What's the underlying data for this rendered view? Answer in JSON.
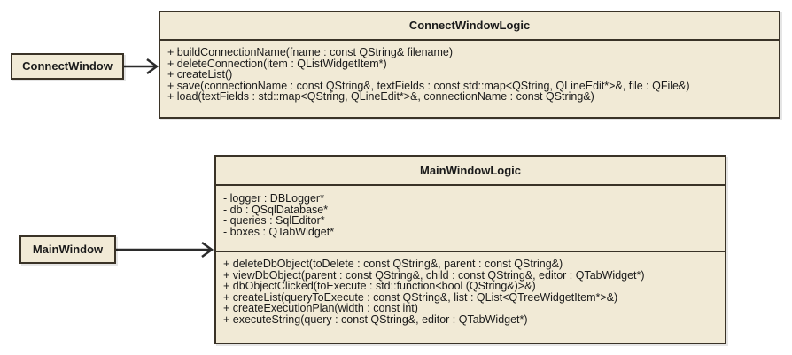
{
  "colors": {
    "box_fill": "#f1ead6",
    "border": "#3a3327",
    "text": "#1a1a1a"
  },
  "connect_window_logic": {
    "title": "ConnectWindowLogic",
    "operations": [
      "+ buildConnectionName(fname : const QString& filename)",
      "+ deleteConnection(item : QListWidgetItem*)",
      "+ createList()",
      "+ save(connectionName : const QString&, textFields : const std::map<QString, QLineEdit*>&, file : QFile&)",
      "+ load(textFields : std::map<QString, QLineEdit*>&, connectionName : const QString&)"
    ]
  },
  "connect_window": {
    "title": "ConnectWindow"
  },
  "main_window_logic": {
    "title": "MainWindowLogic",
    "attributes": [
      "- logger : DBLogger*",
      "- db : QSqlDatabase*",
      "- queries : SqlEditor*",
      "- boxes : QTabWidget*"
    ],
    "operations": [
      "+ deleteDbObject(toDelete : const QString&, parent : const QString&)",
      "+ viewDbObject(parent : const QString&, child : const QString&, editor : QTabWidget*)",
      "+ dbObjectClicked(toExecute : std::function<bool (QString&)>&)",
      "+ createList(queryToExecute : const QString&, list : QList<QTreeWidgetItem*>&)",
      "+ createExecutionPlan(width : const int)",
      "+ executeString(query : const QString&, editor : QTabWidget*)"
    ]
  },
  "main_window": {
    "title": "MainWindow"
  }
}
